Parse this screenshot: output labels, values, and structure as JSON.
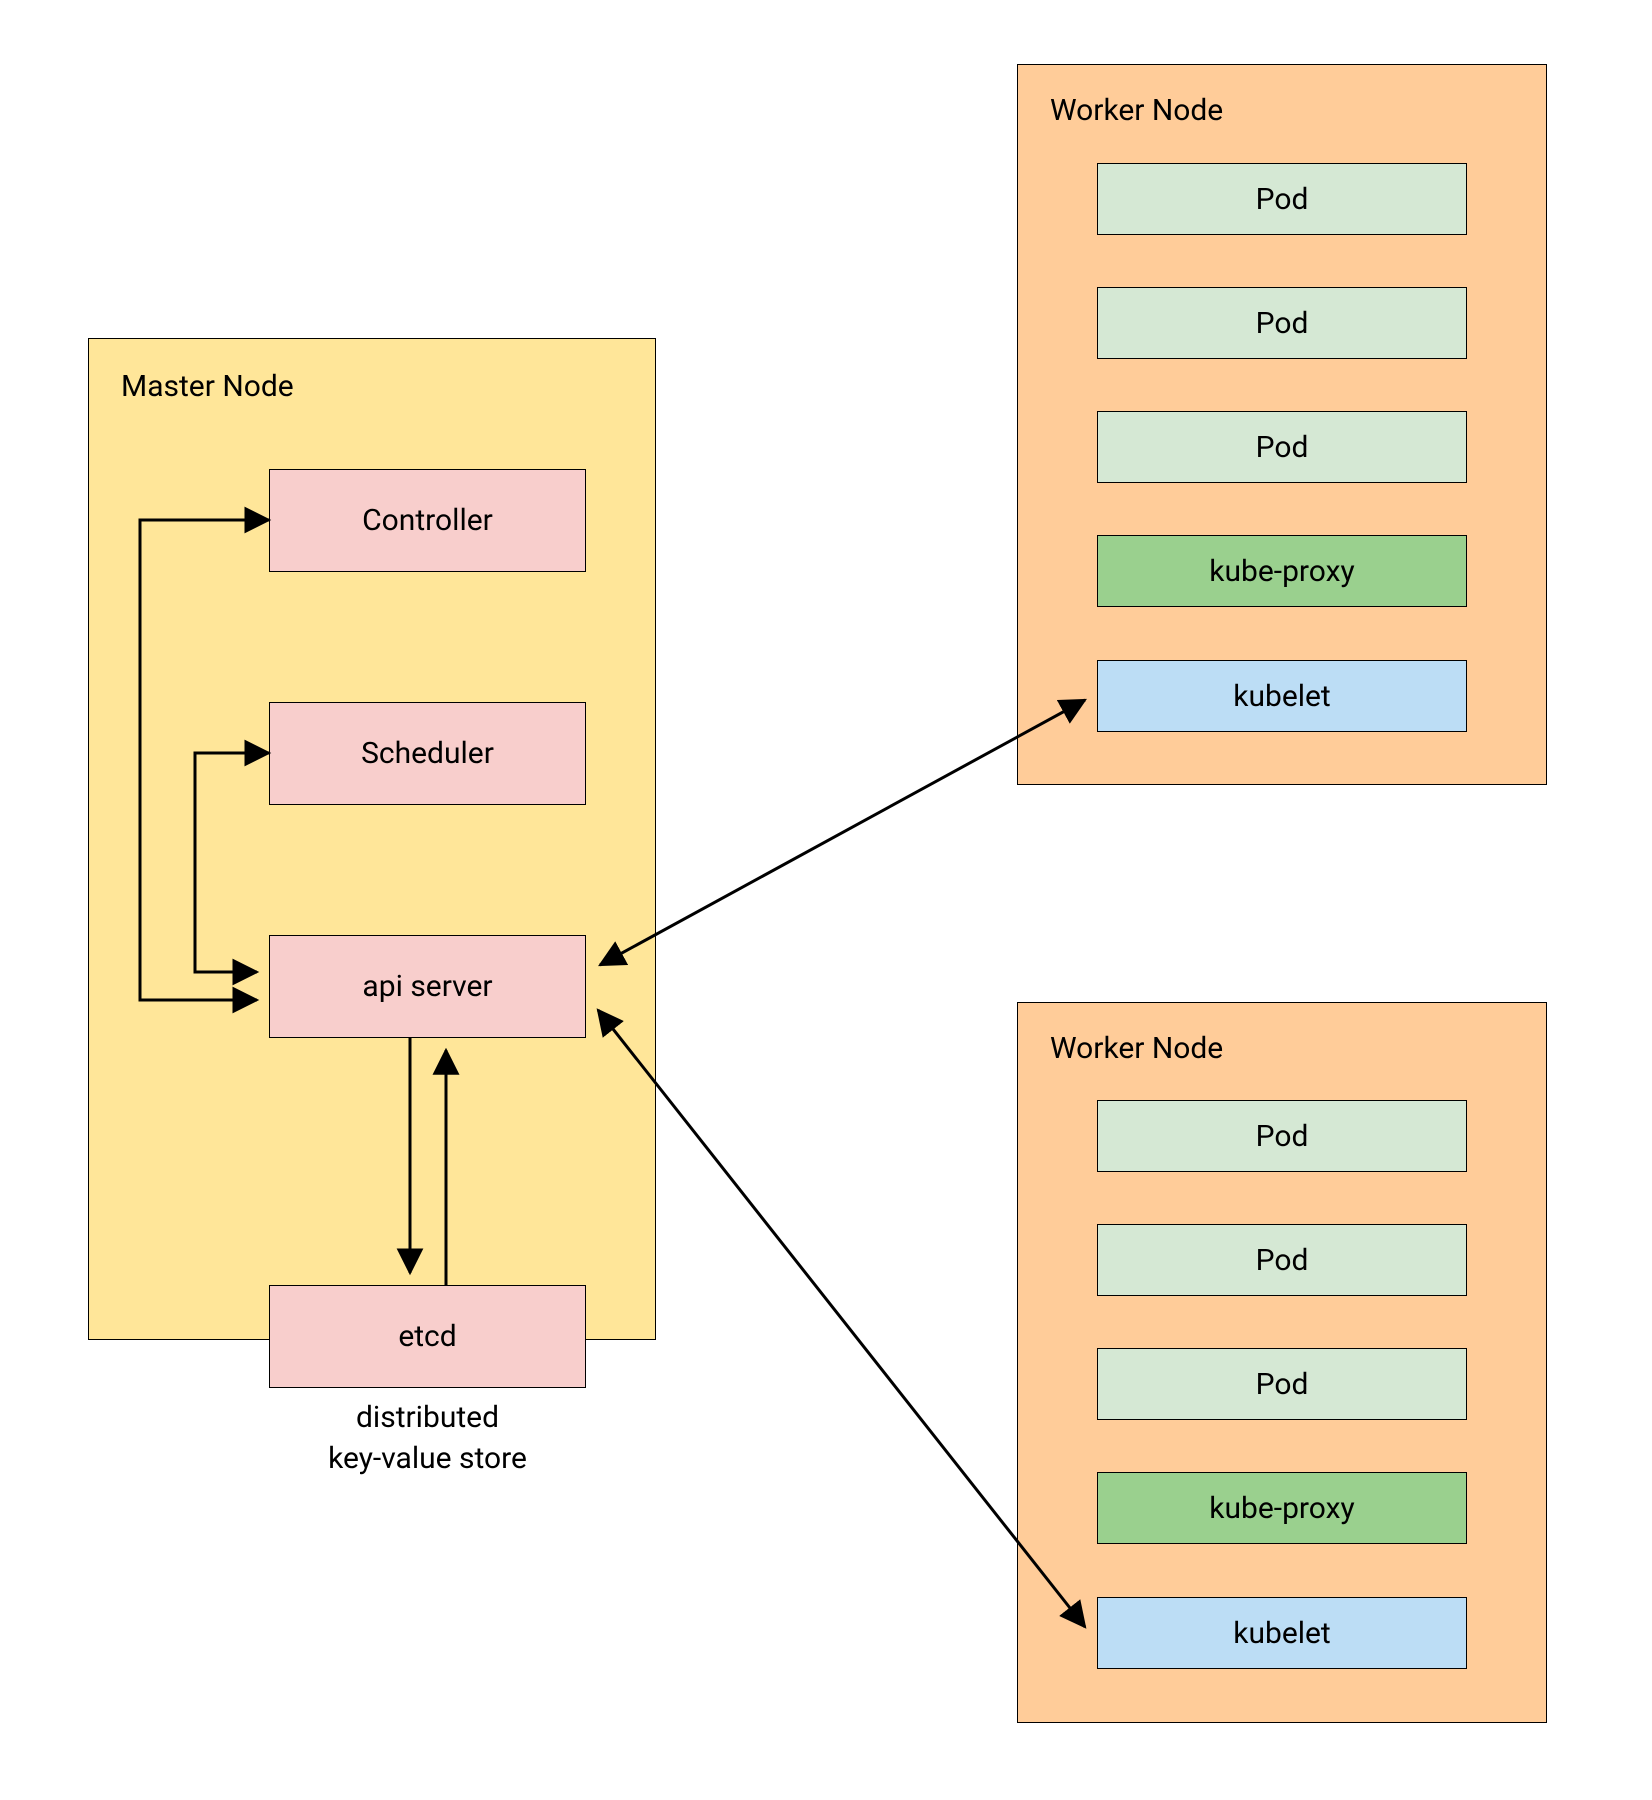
{
  "colors": {
    "master_bg": "#ffe699",
    "worker_bg": "#ffcc99",
    "pink": "#f8cecc",
    "pale_green": "#d5e8d4",
    "green": "#9ad08e",
    "blue": "#bcddf5"
  },
  "master": {
    "title": "Master Node",
    "controller": "Controller",
    "scheduler": "Scheduler",
    "api_server": "api server",
    "etcd": "etcd",
    "etcd_caption_l1": "distributed",
    "etcd_caption_l2": "key-value store"
  },
  "worker1": {
    "title": "Worker Node",
    "pods": [
      "Pod",
      "Pod",
      "Pod"
    ],
    "kube_proxy": "kube-proxy",
    "kubelet": "kubelet"
  },
  "worker2": {
    "title": "Worker Node",
    "pods": [
      "Pod",
      "Pod",
      "Pod"
    ],
    "kube_proxy": "kube-proxy",
    "kubelet": "kubelet"
  }
}
